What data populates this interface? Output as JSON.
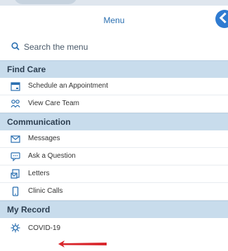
{
  "header": {
    "title": "Menu"
  },
  "search": {
    "placeholder": "Search the menu"
  },
  "sections": [
    {
      "title": "Find Care",
      "items": [
        {
          "label": "Schedule an Appointment",
          "icon": "calendar-icon"
        },
        {
          "label": "View Care Team",
          "icon": "care-team-icon"
        }
      ]
    },
    {
      "title": "Communication",
      "items": [
        {
          "label": "Messages",
          "icon": "envelope-icon"
        },
        {
          "label": "Ask a Question",
          "icon": "chat-bubble-icon"
        },
        {
          "label": "Letters",
          "icon": "letter-icon"
        },
        {
          "label": "Clinic Calls",
          "icon": "phone-icon"
        }
      ]
    },
    {
      "title": "My Record",
      "items": [
        {
          "label": "COVID-19",
          "icon": "virus-icon"
        }
      ]
    }
  ],
  "colors": {
    "accent": "#2a6fb0",
    "section_bg": "#c8dcec",
    "annotation_arrow": "#d9252b"
  }
}
